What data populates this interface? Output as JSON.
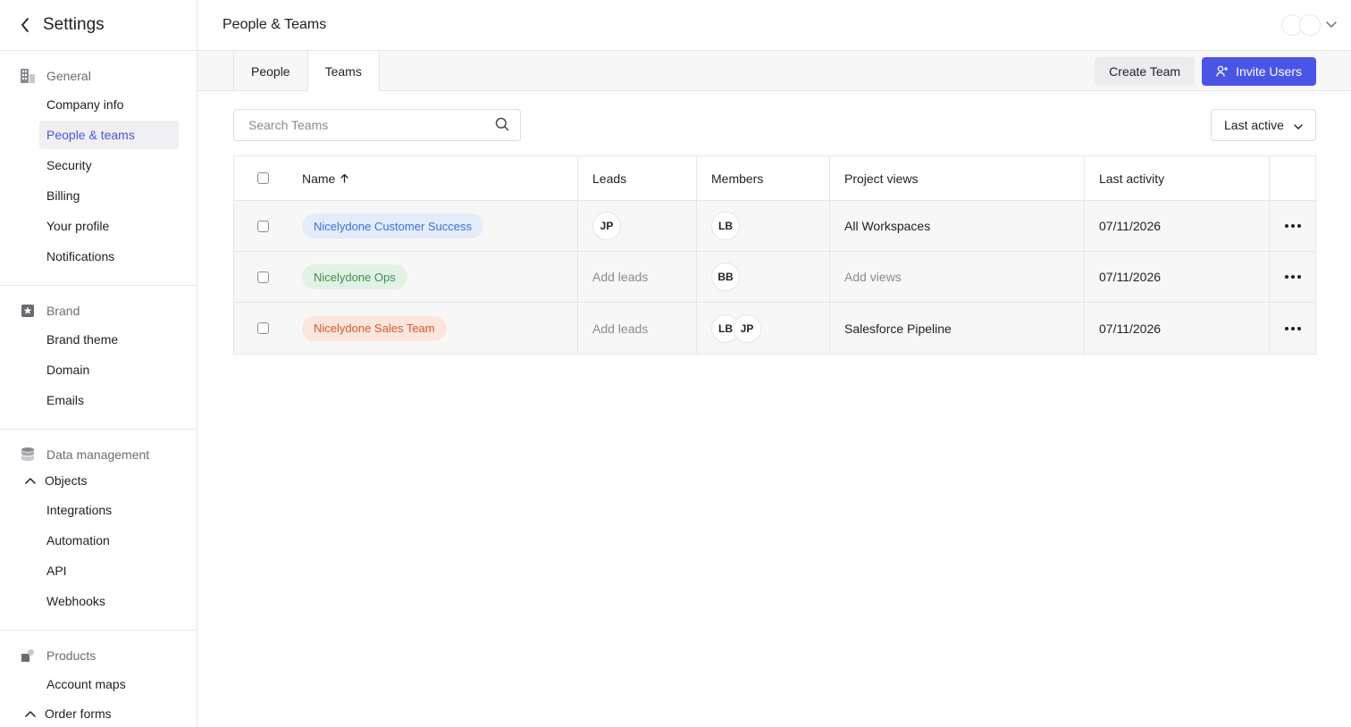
{
  "sidebar": {
    "title": "Settings",
    "sections": [
      {
        "group": "General",
        "icon": "building-icon",
        "items": [
          "Company info",
          "People & teams",
          "Security",
          "Billing",
          "Your profile",
          "Notifications"
        ]
      },
      {
        "group": "Brand",
        "icon": "star-badge-icon",
        "items": [
          "Brand theme",
          "Domain",
          "Emails"
        ]
      },
      {
        "group": "Data management",
        "icon": "database-icon",
        "objects_label": "Objects",
        "items": [
          "Integrations",
          "Automation",
          "API",
          "Webhooks"
        ]
      },
      {
        "group": "Products",
        "icon": "products-icon",
        "items": [
          "Account maps"
        ],
        "order_forms_label": "Order forms"
      }
    ],
    "active_item": "People & teams"
  },
  "header": {
    "title": "People & Teams"
  },
  "tabs": [
    {
      "label": "People",
      "active": false
    },
    {
      "label": "Teams",
      "active": true
    }
  ],
  "actions": {
    "create_team": "Create Team",
    "invite_users": "Invite Users"
  },
  "search": {
    "placeholder": "Search Teams",
    "value": ""
  },
  "sort": {
    "label": "Last active"
  },
  "table": {
    "headers": {
      "name": "Name",
      "leads": "Leads",
      "members": "Members",
      "views": "Project views",
      "activity": "Last activity"
    },
    "rows": [
      {
        "name": "Nicelydone Customer Success",
        "color": "blue",
        "leads": [
          "JP"
        ],
        "leads_placeholder": "",
        "members": [
          "LB"
        ],
        "views": "All Workspaces",
        "views_placeholder": "",
        "activity": "07/11/2026"
      },
      {
        "name": "Nicelydone Ops",
        "color": "green",
        "leads": [],
        "leads_placeholder": "Add leads",
        "members": [
          "BB"
        ],
        "views": "",
        "views_placeholder": "Add views",
        "activity": "07/11/2026"
      },
      {
        "name": "Nicelydone Sales Team",
        "color": "orange",
        "leads": [],
        "leads_placeholder": "Add leads",
        "members": [
          "LB",
          "JP"
        ],
        "views": "Salesforce Pipeline",
        "views_placeholder": "",
        "activity": "07/11/2026"
      }
    ]
  },
  "colors": {
    "accent": "#4a55e8",
    "active_text": "#4a55d8"
  }
}
